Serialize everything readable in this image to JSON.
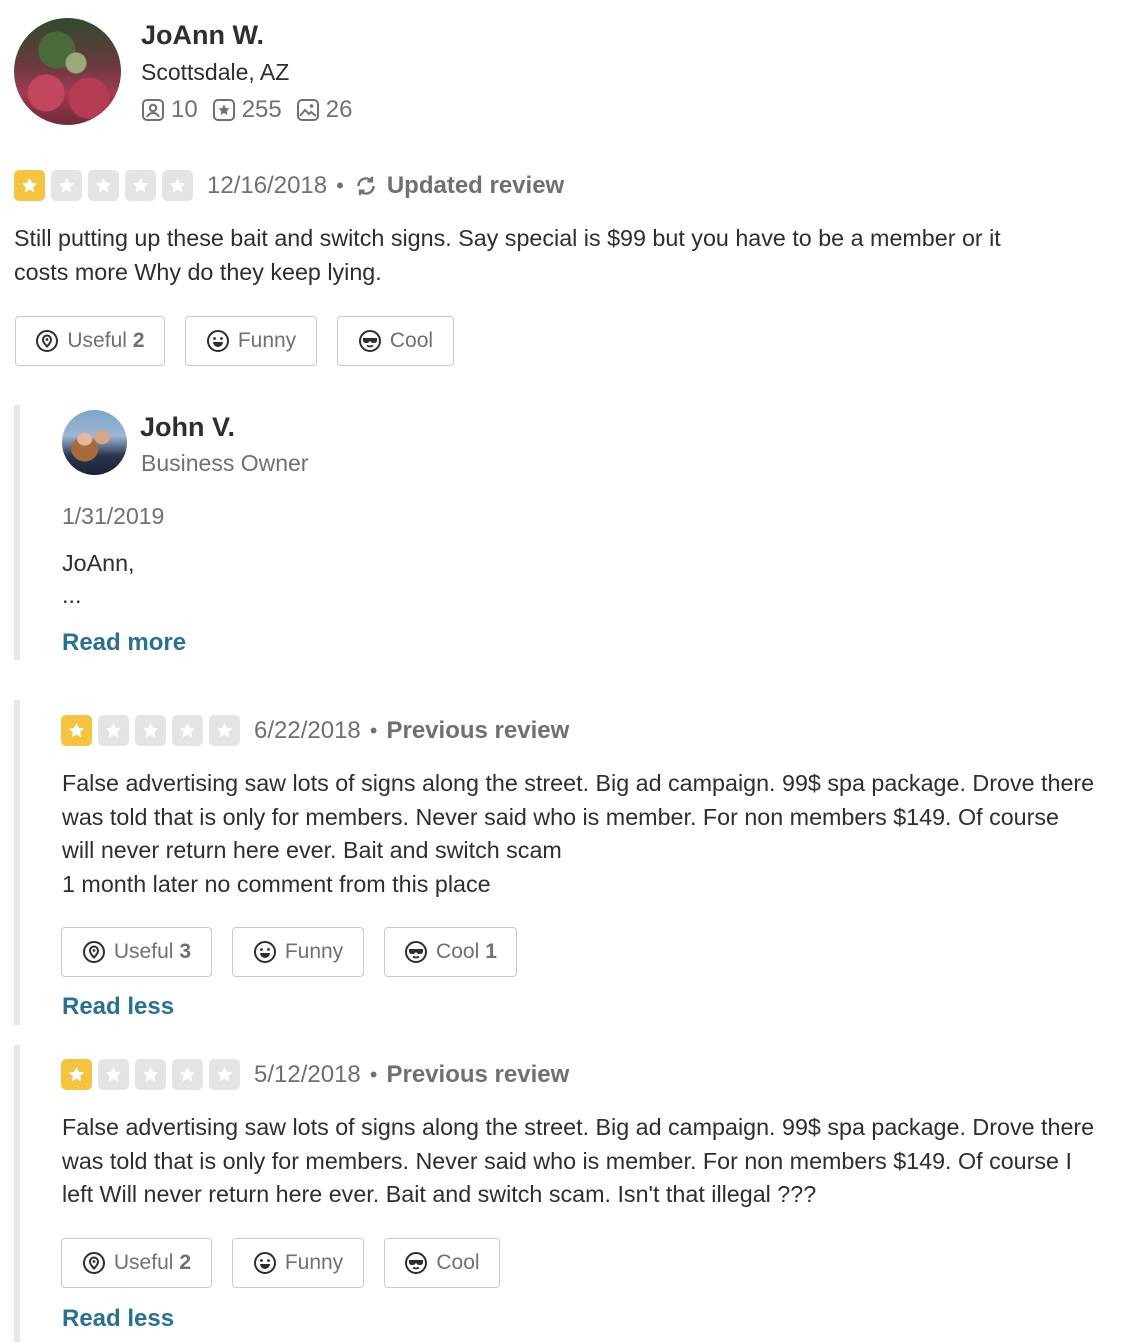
{
  "reviewer": {
    "name": "JoAnn W.",
    "location": "Scottsdale, AZ",
    "friends_count": "10",
    "reviews_count": "255",
    "photos_count": "26"
  },
  "current_review": {
    "rating": 1,
    "date": "12/16/2018",
    "status": "Updated review",
    "text_line1": "Still putting up these bait and switch signs. Say special is $99 but you have to be a member  or it",
    "text_line2": "costs more Why do they keep lying.",
    "useful_label": "Useful",
    "useful_count": "2",
    "funny_label": "Funny",
    "funny_count": "",
    "cool_label": "Cool",
    "cool_count": ""
  },
  "owner_reply": {
    "name": "John V.",
    "role": "Business Owner",
    "date": "1/31/2019",
    "text_line1": "JoAnn,",
    "text_line2": "...",
    "read_more": "Read more"
  },
  "previous_reviews": [
    {
      "rating": 1,
      "date": "6/22/2018",
      "status": "Previous review",
      "line1": "False advertising saw lots of signs along the street. Big ad campaign. 99$ spa package. Drove there",
      "line2": "was told that is only for members. Never said who is member. For non members $149. Of course",
      "line3": "will never return here ever.  Bait and switch scam",
      "line4": "1 month later no comment from this place",
      "useful_label": "Useful",
      "useful_count": "3",
      "funny_label": "Funny",
      "funny_count": "",
      "cool_label": "Cool",
      "cool_count": "1",
      "read_less": "Read less"
    },
    {
      "rating": 1,
      "date": "5/12/2018",
      "status": "Previous review",
      "line1": "False advertising saw lots of signs along the street. Big ad campaign. 99$ spa package. Drove there",
      "line2": "was told that is only for members. Never said who is member. For non members $149. Of course I",
      "line3": "left Will never return here ever.  Bait and switch scam. Isn't that illegal ???",
      "useful_label": "Useful",
      "useful_count": "2",
      "funny_label": "Funny",
      "funny_count": "",
      "cool_label": "Cool",
      "cool_count": "",
      "read_less": "Read less"
    }
  ],
  "colors": {
    "star_on": "#f5c342",
    "star_off": "#e4e4e4",
    "link": "#2b6f94"
  }
}
